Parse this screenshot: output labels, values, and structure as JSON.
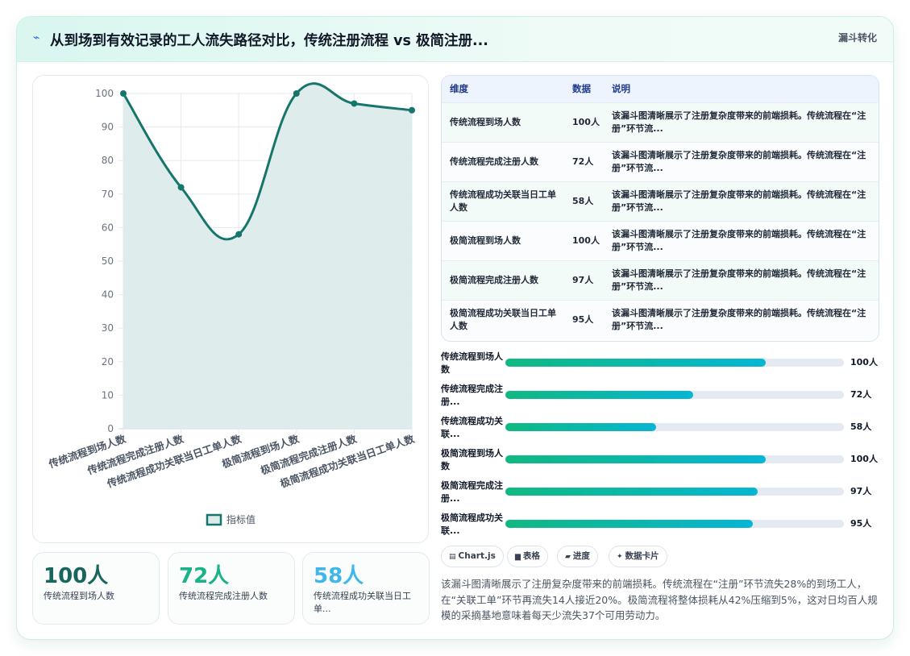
{
  "header": {
    "title_icon": "lightning-icon",
    "title": "从到场到有效记录的工人流失路径对比，传统注册流程 vs 极简注册...",
    "tag": "漏斗转化"
  },
  "chart_data": {
    "type": "area",
    "categories": [
      "传统流程到场人数",
      "传统流程完成注册人数",
      "传统流程成功关联当日工单人数",
      "极简流程到场人数",
      "极简流程完成注册人数",
      "极简流程成功关联当日工单人数"
    ],
    "series": [
      {
        "name": "指标值",
        "values": [
          100,
          72,
          58,
          100,
          97,
          95
        ]
      }
    ],
    "ylim": [
      0,
      100
    ],
    "yticks": [
      0,
      10,
      20,
      30,
      40,
      50,
      60,
      70,
      80,
      90,
      100
    ],
    "legend": "bottom",
    "grid": true,
    "colors": {
      "line": "#17766b",
      "fill": "#dcebea"
    }
  },
  "kpis": [
    {
      "value": "100人",
      "label": "传统流程到场人数",
      "color": "#17665d"
    },
    {
      "value": "72人",
      "label": "传统流程完成注册人数",
      "color": "#19b388"
    },
    {
      "value": "58人",
      "label": "传统流程成功关联当日工单...",
      "color": "#3fb7e8"
    }
  ],
  "table": {
    "headers": [
      "维度",
      "数据",
      "说明"
    ],
    "rows": [
      {
        "dim": "传统流程到场人数",
        "val": "100人",
        "desc": "该漏斗图清晰展示了注册复杂度带来的前端损耗。传统流程在“注册”环节流..."
      },
      {
        "dim": "传统流程完成注册人数",
        "val": "72人",
        "desc": "该漏斗图清晰展示了注册复杂度带来的前端损耗。传统流程在“注册”环节流..."
      },
      {
        "dim": "传统流程成功关联当日工单人数",
        "val": "58人",
        "desc": "该漏斗图清晰展示了注册复杂度带来的前端损耗。传统流程在“注册”环节流..."
      },
      {
        "dim": "极简流程到场人数",
        "val": "100人",
        "desc": "该漏斗图清晰展示了注册复杂度带来的前端损耗。传统流程在“注册”环节流..."
      },
      {
        "dim": "极简流程完成注册人数",
        "val": "97人",
        "desc": "该漏斗图清晰展示了注册复杂度带来的前端损耗。传统流程在“注册”环节流..."
      },
      {
        "dim": "极简流程成功关联当日工单人数",
        "val": "95人",
        "desc": "该漏斗图清晰展示了注册复杂度带来的前端损耗。传统流程在“注册”环节流..."
      }
    ]
  },
  "progress": [
    {
      "label": "传统流程到场人数",
      "value": 100,
      "value_label": "100人"
    },
    {
      "label": "传统流程完成注册...",
      "value": 72,
      "value_label": "72人"
    },
    {
      "label": "传统流程成功关联...",
      "value": 58,
      "value_label": "58人"
    },
    {
      "label": "极简流程到场人数",
      "value": 100,
      "value_label": "100人"
    },
    {
      "label": "极简流程完成注册...",
      "value": 97,
      "value_label": "97人"
    },
    {
      "label": "极简流程成功关联...",
      "value": 95,
      "value_label": "95人"
    }
  ],
  "progress_max": 130,
  "chips": [
    {
      "icon": "chart-icon",
      "glyph": "▤",
      "label": "Chart.js"
    },
    {
      "icon": "table-icon",
      "glyph": "▆",
      "label": "表格"
    },
    {
      "icon": "progress-icon",
      "glyph": "▰",
      "label": "进度"
    },
    {
      "icon": "sparkle-icon",
      "glyph": "✦",
      "label": "数据卡片"
    }
  ],
  "summary": "该漏斗图清晰展示了注册复杂度带来的前端损耗。传统流程在“注册”环节流失28%的到场工人，在“关联工单”环节再流失14人接近20%。极简流程将整体损耗从42%压缩到5%，这对日均百人规模的采摘基地意味着每天少流失37个可用劳动力。"
}
